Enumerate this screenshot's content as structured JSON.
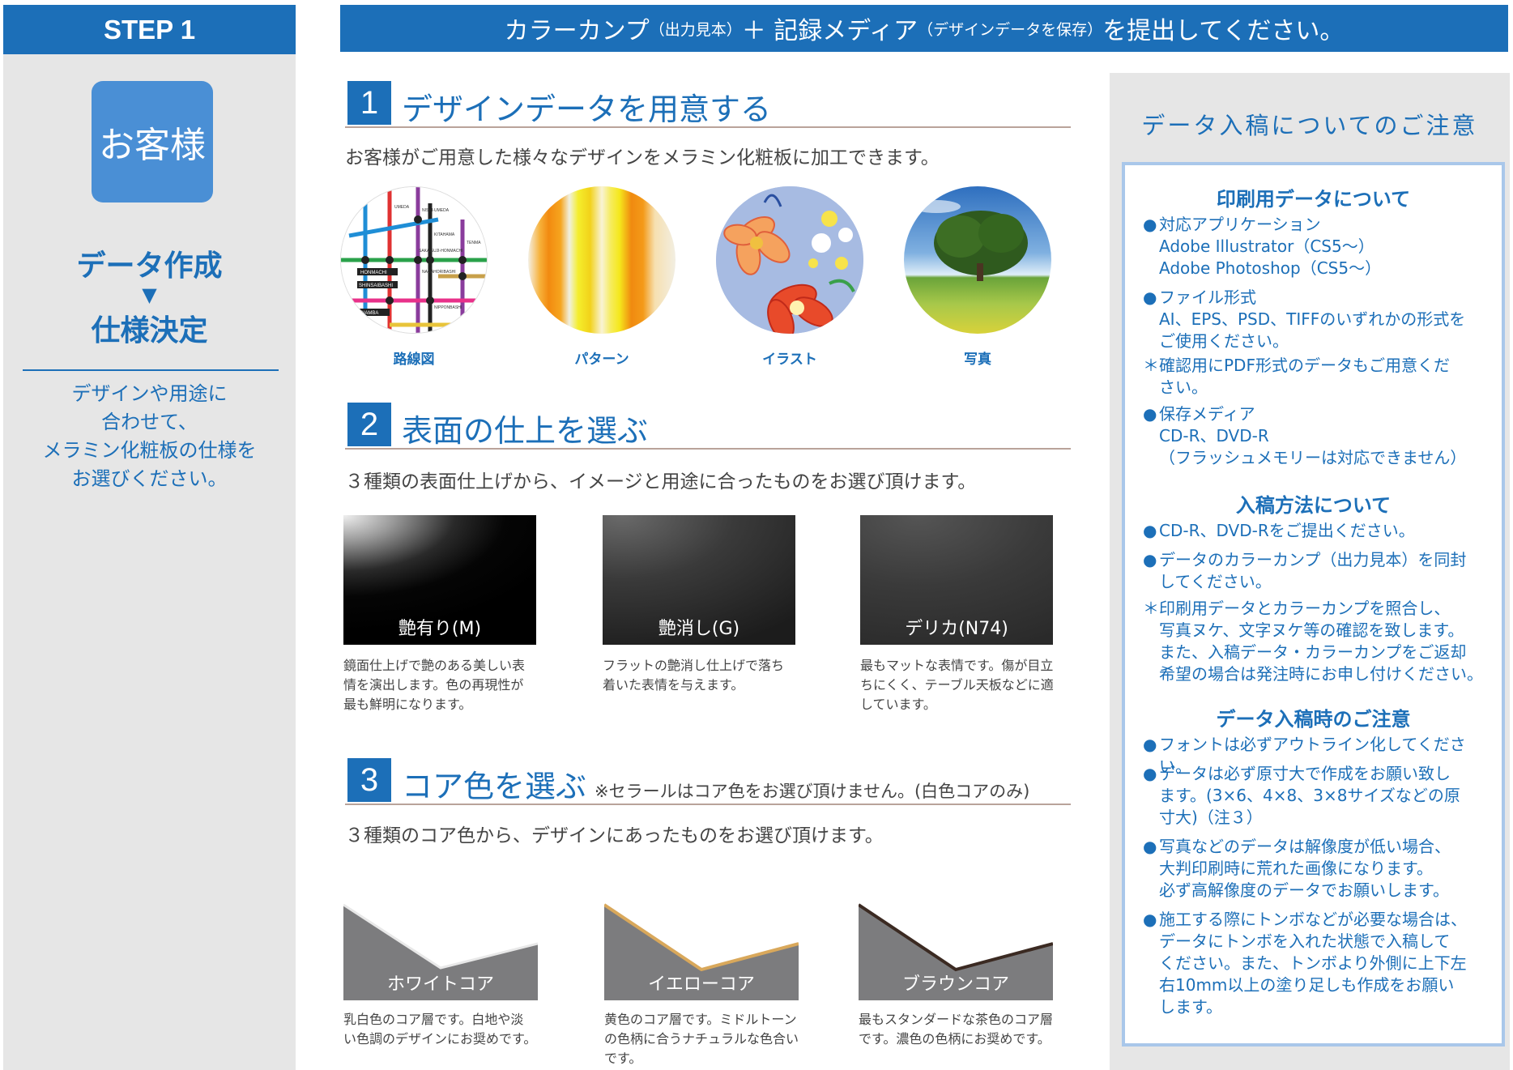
{
  "sidebar": {
    "step": "STEP 1",
    "customer": "お客様",
    "title1": "データ作成",
    "arrow": "▼",
    "title2": "仕様決定",
    "desc": [
      "デザインや用途に",
      "合わせて、",
      "メラミン化粧板の仕様を",
      "お選びください。"
    ]
  },
  "banner": {
    "part1": "カラーカンプ",
    "part2": "（出力見本）",
    "part3": "＋ 記録メディア",
    "part4": "（デザインデータを保存）",
    "part5": "を提出してください。"
  },
  "section1": {
    "num": "1",
    "title": "デザインデータを用意する",
    "lead": "お客様がご用意した様々なデザインをメラミン化粧板に加工できます。",
    "images": [
      {
        "label": "路線図"
      },
      {
        "label": "パターン"
      },
      {
        "label": "イラスト"
      },
      {
        "label": "写真"
      }
    ],
    "map_stations": [
      "UMEDA",
      "NISHI-UMEDA",
      "HONMACHI",
      "SHINSAIBASHI",
      "NAMBA",
      "NAGAHORIBASHI",
      "TENMA",
      "SAKAISUJI-HONMACHI",
      "NIPPONBASHI",
      "KITAHAMA"
    ]
  },
  "section2": {
    "num": "2",
    "title": "表面の仕上を選ぶ",
    "lead": "３種類の表面仕上げから、イメージと用途に合ったものをお選び頂けます。",
    "finishes": [
      {
        "label": "艶有り(M)",
        "desc": [
          "鏡面仕上げで艶のある美しい表",
          "情を演出します。色の再現性が",
          "最も鮮明になります。"
        ]
      },
      {
        "label": "艶消し(G)",
        "desc": [
          "フラットの艶消し仕上げで落ち",
          "着いた表情を与えます。"
        ]
      },
      {
        "label": "デリカ(N74)",
        "desc": [
          "最もマットな表情です。傷が目立",
          "ちにくく、テーブル天板などに適",
          "しています。"
        ]
      }
    ]
  },
  "section3": {
    "num": "3",
    "title": "コア色を選ぶ",
    "note": "※セラールはコア色をお選び頂けません。(白色コアのみ)",
    "lead": "３種類のコア色から、デザインにあったものをお選び頂けます。",
    "cores": [
      {
        "label": "ホワイトコア",
        "edge": "#f4f4f4",
        "desc": [
          "乳白色のコア層です。白地や淡",
          "い色調のデザインにお奨めです。"
        ]
      },
      {
        "label": "イエローコア",
        "edge": "#d9a85b",
        "desc": [
          "黄色のコア層です。ミドルトーン",
          "の色柄に合うナチュラルな色合い",
          "です。"
        ]
      },
      {
        "label": "ブラウンコア",
        "edge": "#3b2a22",
        "desc": [
          "最もスタンダードな茶色のコア層",
          "です。濃色の色柄にお奨めです。"
        ]
      }
    ]
  },
  "notice": {
    "title": "データ入稿についてのご注意",
    "group1": {
      "heading": "印刷用データについて",
      "items": [
        {
          "mark": "●",
          "lines": [
            "対応アプリケーション",
            "Adobe Illustrator（CS5〜）",
            "Adobe Photoshop（CS5〜）"
          ]
        },
        {
          "mark": "●",
          "lines": [
            "ファイル形式",
            "AI、EPS、PSD、TIFFのいずれかの形式を",
            "ご使用ください。"
          ]
        },
        {
          "mark": "＊",
          "lines": [
            "確認用にPDF形式のデータもご用意くだ",
            "さい。"
          ]
        },
        {
          "mark": "●",
          "lines": [
            "保存メディア",
            "CD-R、DVD-R",
            "（フラッシュメモリーは対応できません）"
          ]
        }
      ]
    },
    "group2": {
      "heading": "入稿方法について",
      "items": [
        {
          "mark": "●",
          "lines": [
            "CD-R、DVD-Rをご提出ください。"
          ]
        },
        {
          "mark": "●",
          "lines": [
            "データのカラーカンプ（出力見本）を同封",
            "してください。"
          ]
        },
        {
          "mark": "＊",
          "lines": [
            "印刷用データとカラーカンプを照合し、",
            "写真ヌケ、文字ヌケ等の確認を致します。",
            "また、入稿データ・カラーカンプをご返却",
            "希望の場合は発注時にお申し付けください。"
          ]
        }
      ]
    },
    "group3": {
      "heading": "データ入稿時のご注意",
      "items": [
        {
          "mark": "●",
          "lines": [
            "フォントは必ずアウトライン化してください。"
          ]
        },
        {
          "mark": "●",
          "lines": [
            "データは必ず原寸大で作成をお願い致し",
            "ます。(3×6、4×8、3×8サイズなどの原",
            "寸大)（注３）"
          ]
        },
        {
          "mark": "●",
          "lines": [
            "写真などのデータは解像度が低い場合、",
            "大判印刷時に荒れた画像になります。",
            "必ず高解像度のデータでお願いします。"
          ]
        },
        {
          "mark": "●",
          "lines": [
            "施工する際にトンボなどが必要な場合は、",
            "データにトンボを入れた状態で入稿して",
            "ください。また、トンボより外側に上下左",
            "右10mm以上の塗り足しも作成をお願い",
            "します。"
          ]
        }
      ]
    }
  }
}
